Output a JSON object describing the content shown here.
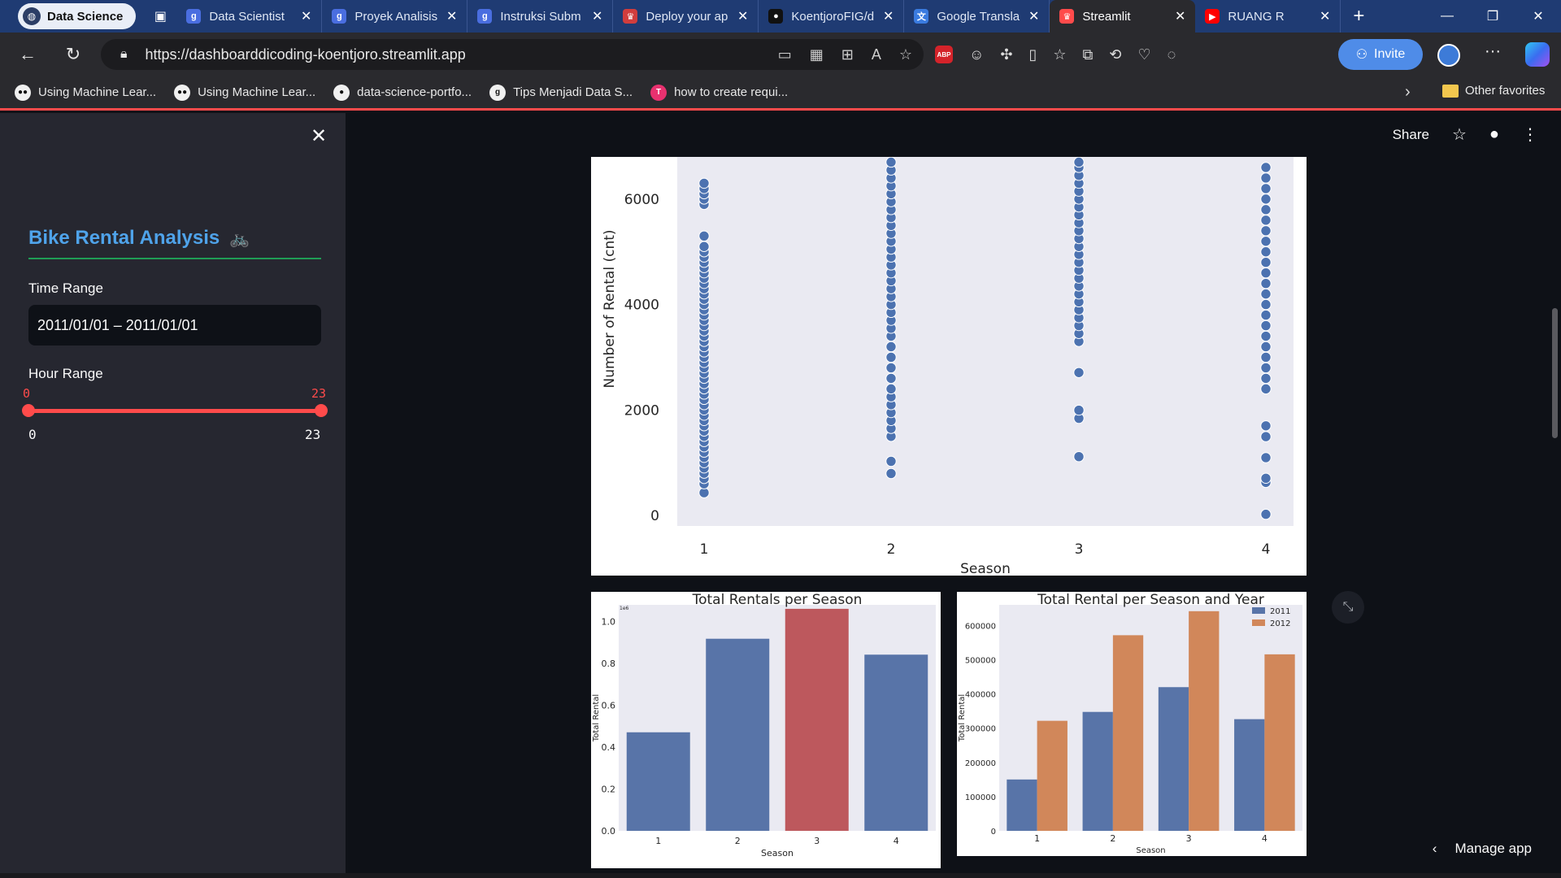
{
  "browser": {
    "profile": "Data Science",
    "tabs": [
      {
        "title": "Data Scientist",
        "icon": "g",
        "color": "#4a6ee0"
      },
      {
        "title": "Proyek Analisis",
        "icon": "g",
        "color": "#4a6ee0"
      },
      {
        "title": "Instruksi Subm",
        "icon": "g",
        "color": "#4a6ee0"
      },
      {
        "title": "Deploy your ap",
        "icon": "crown",
        "color": "#d13d3d"
      },
      {
        "title": "KoentjoroFIG/d",
        "icon": "github",
        "color": "#111111"
      },
      {
        "title": "Google Transla",
        "icon": "translate",
        "color": "#3a7be0"
      },
      {
        "title": "Streamlit",
        "icon": "crown",
        "color": "#ff4b4b"
      },
      {
        "title": "RUANG R",
        "icon": "youtube",
        "color": "#ff0000"
      }
    ],
    "url": "https://dashboarddicoding-koentjoro.streamlit.app",
    "invite_label": "Invite",
    "bookmarks": [
      {
        "label": "Using Machine Lear...",
        "icon": "medium"
      },
      {
        "label": "Using Machine Lear...",
        "icon": "medium"
      },
      {
        "label": "data-science-portfo...",
        "icon": "github"
      },
      {
        "label": "Tips Menjadi Data S...",
        "icon": "g"
      },
      {
        "label": "how to create requi...",
        "icon": "tool"
      }
    ],
    "other_favorites": "Other favorites"
  },
  "sidebar": {
    "title": "Bike Rental Analysis",
    "title_emoji": "🚲",
    "time_range_label": "Time Range",
    "time_range_value": "2011/01/01 – 2011/01/01",
    "hour_range_label": "Hour Range",
    "hour_min": "0",
    "hour_max": "23",
    "hour_tick_min": "0",
    "hour_tick_max": "23"
  },
  "header": {
    "share": "Share"
  },
  "manage_app": "Manage app",
  "chart_data": [
    {
      "type": "scatter",
      "title": "",
      "xlabel": "Season",
      "ylabel": "Number of Rental (cnt)",
      "xticks": [
        "1",
        "2",
        "3",
        "4"
      ],
      "yticks": [
        "0",
        "2000",
        "4000",
        "6000"
      ],
      "ylim": [
        -200,
        6800
      ],
      "grid": false,
      "series": [
        {
          "x": 1,
          "values": [
            431,
            600,
            700,
            800,
            900,
            1000,
            1100,
            1200,
            1300,
            1400,
            1500,
            1600,
            1700,
            1800,
            1900,
            2000,
            2100,
            2200,
            2300,
            2400,
            2500,
            2600,
            2700,
            2800,
            2900,
            3000,
            3100,
            3200,
            3300,
            3400,
            3500,
            3600,
            3700,
            3800,
            3900,
            4000,
            4100,
            4200,
            4300,
            4400,
            4500,
            4600,
            4700,
            4800,
            4900,
            5000,
            5100,
            5300,
            5900,
            6000,
            6100,
            6200,
            6300
          ]
        },
        {
          "x": 2,
          "values": [
            795,
            1027,
            1500,
            1650,
            1800,
            1950,
            2100,
            2250,
            2400,
            2600,
            2800,
            3000,
            3200,
            3400,
            3550,
            3700,
            3850,
            4000,
            4150,
            4300,
            4450,
            4600,
            4750,
            4900,
            5050,
            5200,
            5350,
            5500,
            5650,
            5800,
            5950,
            6100,
            6250,
            6400,
            6550,
            6700
          ]
        },
        {
          "x": 3,
          "values": [
            1115,
            1842,
            1996,
            2710,
            3300,
            3450,
            3600,
            3750,
            3900,
            4050,
            4200,
            4350,
            4500,
            4650,
            4800,
            4950,
            5100,
            5250,
            5400,
            5550,
            5700,
            5850,
            6000,
            6150,
            6300,
            6450,
            6600,
            6700
          ]
        },
        {
          "x": 4,
          "values": [
            22,
            627,
            705,
            1096,
            1495,
            1700,
            2400,
            2600,
            2800,
            3000,
            3200,
            3400,
            3600,
            3800,
            4000,
            4200,
            4400,
            4600,
            4800,
            5000,
            5200,
            5400,
            5600,
            5800,
            6000,
            6200,
            6400,
            6600
          ]
        }
      ]
    },
    {
      "type": "bar",
      "title": "Total Rentals per Season",
      "xlabel": "Season",
      "ylabel": "Total Rental",
      "scale_note": "1e6",
      "categories": [
        "1",
        "2",
        "3",
        "4"
      ],
      "values": [
        0.471,
        0.918,
        1.061,
        0.842
      ],
      "ylim": [
        0,
        1.08
      ],
      "yticks": [
        "0.0",
        "0.2",
        "0.4",
        "0.6",
        "0.8",
        "1.0"
      ],
      "colors": [
        "#5874a8",
        "#5874a8",
        "#bd585d",
        "#5874a8"
      ]
    },
    {
      "type": "bar",
      "title": "Total Rental per Season and Year",
      "xlabel": "Season",
      "ylabel": "Total Rental",
      "categories": [
        "1",
        "2",
        "3",
        "4"
      ],
      "ylim": [
        0,
        660000
      ],
      "yticks": [
        "0",
        "100000",
        "200000",
        "300000",
        "400000",
        "500000",
        "600000"
      ],
      "legend": "top-right",
      "series": [
        {
          "name": "2011",
          "values": [
            150000,
            347316,
            419650,
            326137
          ],
          "color": "#5874a8"
        },
        {
          "name": "2012",
          "values": [
            321348,
            571273,
            641479,
            515476
          ],
          "color": "#d1875a"
        }
      ]
    }
  ]
}
